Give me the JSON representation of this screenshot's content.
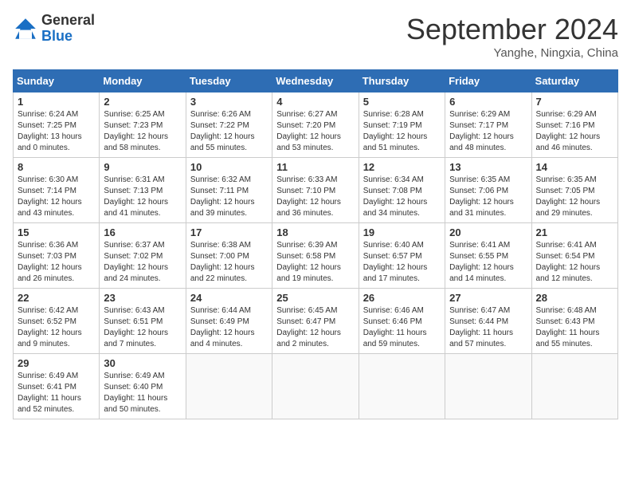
{
  "header": {
    "logo_general": "General",
    "logo_blue": "Blue",
    "month_title": "September 2024",
    "subtitle": "Yanghe, Ningxia, China"
  },
  "days_of_week": [
    "Sunday",
    "Monday",
    "Tuesday",
    "Wednesday",
    "Thursday",
    "Friday",
    "Saturday"
  ],
  "weeks": [
    [
      {
        "day": "1",
        "info": "Sunrise: 6:24 AM\nSunset: 7:25 PM\nDaylight: 13 hours\nand 0 minutes."
      },
      {
        "day": "2",
        "info": "Sunrise: 6:25 AM\nSunset: 7:23 PM\nDaylight: 12 hours\nand 58 minutes."
      },
      {
        "day": "3",
        "info": "Sunrise: 6:26 AM\nSunset: 7:22 PM\nDaylight: 12 hours\nand 55 minutes."
      },
      {
        "day": "4",
        "info": "Sunrise: 6:27 AM\nSunset: 7:20 PM\nDaylight: 12 hours\nand 53 minutes."
      },
      {
        "day": "5",
        "info": "Sunrise: 6:28 AM\nSunset: 7:19 PM\nDaylight: 12 hours\nand 51 minutes."
      },
      {
        "day": "6",
        "info": "Sunrise: 6:29 AM\nSunset: 7:17 PM\nDaylight: 12 hours\nand 48 minutes."
      },
      {
        "day": "7",
        "info": "Sunrise: 6:29 AM\nSunset: 7:16 PM\nDaylight: 12 hours\nand 46 minutes."
      }
    ],
    [
      {
        "day": "8",
        "info": "Sunrise: 6:30 AM\nSunset: 7:14 PM\nDaylight: 12 hours\nand 43 minutes."
      },
      {
        "day": "9",
        "info": "Sunrise: 6:31 AM\nSunset: 7:13 PM\nDaylight: 12 hours\nand 41 minutes."
      },
      {
        "day": "10",
        "info": "Sunrise: 6:32 AM\nSunset: 7:11 PM\nDaylight: 12 hours\nand 39 minutes."
      },
      {
        "day": "11",
        "info": "Sunrise: 6:33 AM\nSunset: 7:10 PM\nDaylight: 12 hours\nand 36 minutes."
      },
      {
        "day": "12",
        "info": "Sunrise: 6:34 AM\nSunset: 7:08 PM\nDaylight: 12 hours\nand 34 minutes."
      },
      {
        "day": "13",
        "info": "Sunrise: 6:35 AM\nSunset: 7:06 PM\nDaylight: 12 hours\nand 31 minutes."
      },
      {
        "day": "14",
        "info": "Sunrise: 6:35 AM\nSunset: 7:05 PM\nDaylight: 12 hours\nand 29 minutes."
      }
    ],
    [
      {
        "day": "15",
        "info": "Sunrise: 6:36 AM\nSunset: 7:03 PM\nDaylight: 12 hours\nand 26 minutes."
      },
      {
        "day": "16",
        "info": "Sunrise: 6:37 AM\nSunset: 7:02 PM\nDaylight: 12 hours\nand 24 minutes."
      },
      {
        "day": "17",
        "info": "Sunrise: 6:38 AM\nSunset: 7:00 PM\nDaylight: 12 hours\nand 22 minutes."
      },
      {
        "day": "18",
        "info": "Sunrise: 6:39 AM\nSunset: 6:58 PM\nDaylight: 12 hours\nand 19 minutes."
      },
      {
        "day": "19",
        "info": "Sunrise: 6:40 AM\nSunset: 6:57 PM\nDaylight: 12 hours\nand 17 minutes."
      },
      {
        "day": "20",
        "info": "Sunrise: 6:41 AM\nSunset: 6:55 PM\nDaylight: 12 hours\nand 14 minutes."
      },
      {
        "day": "21",
        "info": "Sunrise: 6:41 AM\nSunset: 6:54 PM\nDaylight: 12 hours\nand 12 minutes."
      }
    ],
    [
      {
        "day": "22",
        "info": "Sunrise: 6:42 AM\nSunset: 6:52 PM\nDaylight: 12 hours\nand 9 minutes."
      },
      {
        "day": "23",
        "info": "Sunrise: 6:43 AM\nSunset: 6:51 PM\nDaylight: 12 hours\nand 7 minutes."
      },
      {
        "day": "24",
        "info": "Sunrise: 6:44 AM\nSunset: 6:49 PM\nDaylight: 12 hours\nand 4 minutes."
      },
      {
        "day": "25",
        "info": "Sunrise: 6:45 AM\nSunset: 6:47 PM\nDaylight: 12 hours\nand 2 minutes."
      },
      {
        "day": "26",
        "info": "Sunrise: 6:46 AM\nSunset: 6:46 PM\nDaylight: 11 hours\nand 59 minutes."
      },
      {
        "day": "27",
        "info": "Sunrise: 6:47 AM\nSunset: 6:44 PM\nDaylight: 11 hours\nand 57 minutes."
      },
      {
        "day": "28",
        "info": "Sunrise: 6:48 AM\nSunset: 6:43 PM\nDaylight: 11 hours\nand 55 minutes."
      }
    ],
    [
      {
        "day": "29",
        "info": "Sunrise: 6:49 AM\nSunset: 6:41 PM\nDaylight: 11 hours\nand 52 minutes."
      },
      {
        "day": "30",
        "info": "Sunrise: 6:49 AM\nSunset: 6:40 PM\nDaylight: 11 hours\nand 50 minutes."
      },
      {
        "day": "",
        "info": ""
      },
      {
        "day": "",
        "info": ""
      },
      {
        "day": "",
        "info": ""
      },
      {
        "day": "",
        "info": ""
      },
      {
        "day": "",
        "info": ""
      }
    ]
  ]
}
